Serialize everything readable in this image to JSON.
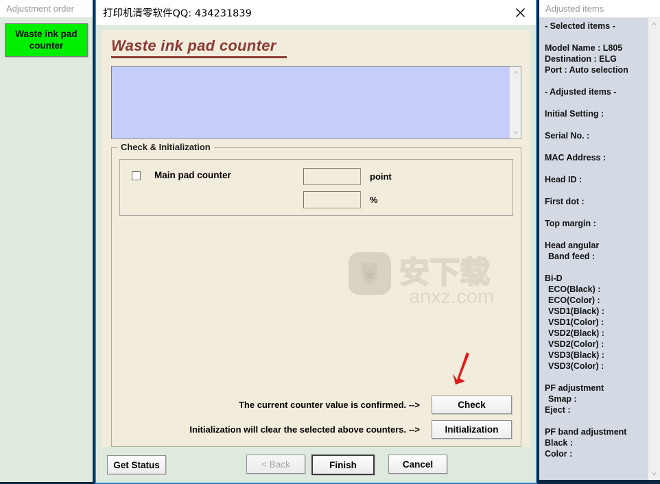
{
  "left_panel": {
    "header": "Adjustment order",
    "order_button_label": "Waste ink pad counter"
  },
  "dialog": {
    "titlebar_text": "打印机清零软件QQ: 434231839",
    "close_icon": "close-icon",
    "page_title": "Waste ink pad counter",
    "log_text": "",
    "scroll_up_icon": "chevron-up-icon",
    "scroll_down_icon": "chevron-down-icon",
    "group": {
      "label": "Check & Initialization",
      "counter_label": "Main pad counter",
      "counter_checked": false,
      "point_value": "",
      "point_unit": "point",
      "percent_value": "",
      "percent_unit": "%"
    },
    "actions": [
      {
        "text": "The current counter value is confirmed. -->",
        "button": "Check"
      },
      {
        "text": "Initialization will clear the selected above counters. -->",
        "button": "Initialization"
      }
    ],
    "buttons": {
      "get_status": "Get Status",
      "back": "< Back",
      "finish": "Finish",
      "cancel": "Cancel"
    }
  },
  "watermark": {
    "cn_text": "安下载",
    "domain_text": "anxz.com",
    "badge_glyph": "安"
  },
  "right_panel": {
    "header": "Adjusted items",
    "items": [
      {
        "text": "- Selected items -",
        "type": "heading"
      },
      {
        "text": "",
        "type": "blank"
      },
      {
        "text": "Model Name : L805",
        "type": "line"
      },
      {
        "text": "Destination : ELG",
        "type": "line"
      },
      {
        "text": "Port : Auto selection",
        "type": "line"
      },
      {
        "text": "",
        "type": "blank"
      },
      {
        "text": "- Adjusted items -",
        "type": "heading"
      },
      {
        "text": "",
        "type": "blank"
      },
      {
        "text": "Initial Setting :",
        "type": "line"
      },
      {
        "text": "",
        "type": "blank"
      },
      {
        "text": "Serial No. :",
        "type": "line"
      },
      {
        "text": "",
        "type": "blank"
      },
      {
        "text": "MAC Address :",
        "type": "line"
      },
      {
        "text": "",
        "type": "blank"
      },
      {
        "text": "Head ID :",
        "type": "line"
      },
      {
        "text": "",
        "type": "blank"
      },
      {
        "text": "First dot :",
        "type": "line"
      },
      {
        "text": "",
        "type": "blank"
      },
      {
        "text": "Top margin :",
        "type": "line"
      },
      {
        "text": "",
        "type": "blank"
      },
      {
        "text": "Head angular",
        "type": "line"
      },
      {
        "text": "Band feed :",
        "type": "indent"
      },
      {
        "text": "",
        "type": "blank"
      },
      {
        "text": "Bi-D",
        "type": "line"
      },
      {
        "text": "ECO(Black)  :",
        "type": "indent"
      },
      {
        "text": "ECO(Color)  :",
        "type": "indent"
      },
      {
        "text": "VSD1(Black) :",
        "type": "indent"
      },
      {
        "text": "VSD1(Color) :",
        "type": "indent"
      },
      {
        "text": "VSD2(Black) :",
        "type": "indent"
      },
      {
        "text": "VSD2(Color) :",
        "type": "indent"
      },
      {
        "text": "VSD3(Black) :",
        "type": "indent"
      },
      {
        "text": "VSD3(Color) :",
        "type": "indent"
      },
      {
        "text": "",
        "type": "blank"
      },
      {
        "text": "PF adjustment",
        "type": "line"
      },
      {
        "text": "Smap :",
        "type": "indent"
      },
      {
        "text": "Eject :",
        "type": "line"
      },
      {
        "text": "",
        "type": "blank"
      },
      {
        "text": "PF band adjustment",
        "type": "line"
      },
      {
        "text": "Black :",
        "type": "line"
      },
      {
        "text": "Color :",
        "type": "line"
      }
    ],
    "scroll_up_icon": "chevron-up-icon",
    "scroll_down_icon": "chevron-down-icon"
  },
  "colors": {
    "window_frame": "#0d2642",
    "panel_green": "#dfeadf",
    "content_cream": "#f2ecdc",
    "log_blue": "#c6cdf8",
    "title_red": "#8b3a33",
    "order_green": "#00ef00",
    "right_panel_bg": "#d4dae4",
    "arrow_red": "#e01b1b"
  }
}
